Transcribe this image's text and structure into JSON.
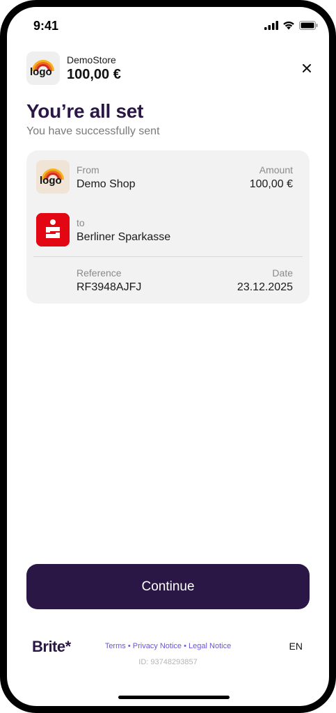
{
  "status_bar": {
    "time": "9:41"
  },
  "merchant": {
    "name": "DemoStore",
    "amount": "100,00 €"
  },
  "success": {
    "title": "You’re all set",
    "subtitle": "You have successfully sent"
  },
  "details": {
    "from_label": "From",
    "from_value": "Demo Shop",
    "amount_label": "Amount",
    "amount_value": "100,00 €",
    "to_label": "to",
    "to_value": "Berliner Sparkasse",
    "reference_label": "Reference",
    "reference_value": "RF3948AJFJ",
    "date_label": "Date",
    "date_value": "23.12.2025"
  },
  "actions": {
    "continue_label": "Continue"
  },
  "footer": {
    "brand": "Brite*",
    "terms": "Terms",
    "privacy": "Privacy Notice",
    "legal": "Legal Notice",
    "separator": "•",
    "id_text": "ID: 93748293857",
    "language": "EN"
  },
  "colors": {
    "brand_purple": "#2a1745",
    "link": "#6a55d4",
    "sparkasse_red": "#e30613"
  },
  "icons": [
    "cellular-signal-icon",
    "wifi-icon",
    "battery-icon",
    "close-icon",
    "merchant-logo",
    "sparkasse-logo"
  ]
}
